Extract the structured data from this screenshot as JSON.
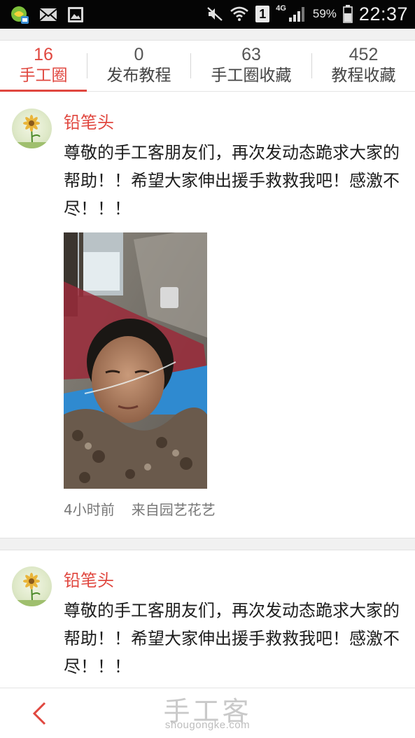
{
  "status_bar": {
    "battery_percent": "59%",
    "time": "22:37",
    "sim": "1",
    "network": "4G"
  },
  "tabs": [
    {
      "count": "16",
      "label": "手工圈",
      "active": true
    },
    {
      "count": "0",
      "label": "发布教程",
      "active": false
    },
    {
      "count": "63",
      "label": "手工圈收藏",
      "active": false
    },
    {
      "count": "452",
      "label": "教程收藏",
      "active": false
    }
  ],
  "posts": [
    {
      "author": "铅笔头",
      "content": "尊敬的手工客朋友们，再次发动态跪求大家的帮助！！希望大家伸出援手救救我吧！感激不尽！！！",
      "time": "4小时前",
      "source": "来自园艺花艺"
    },
    {
      "author": "铅笔头",
      "content": "尊敬的手工客朋友们，再次发动态跪求大家的帮助！！希望大家伸出援手救救我吧！感激不尽！！！"
    }
  ],
  "watermark": {
    "title": "手工客",
    "subtitle": "shougongke.com"
  },
  "colors": {
    "accent": "#e0473f",
    "status_bar": "#050505",
    "background": "#ffffff",
    "divider": "#f1f1f1"
  },
  "icons": [
    "app-badge-icon",
    "mail-icon",
    "picture-icon",
    "mute-icon",
    "wifi-icon",
    "signal-icon",
    "battery-icon",
    "back-arrow-icon"
  ]
}
